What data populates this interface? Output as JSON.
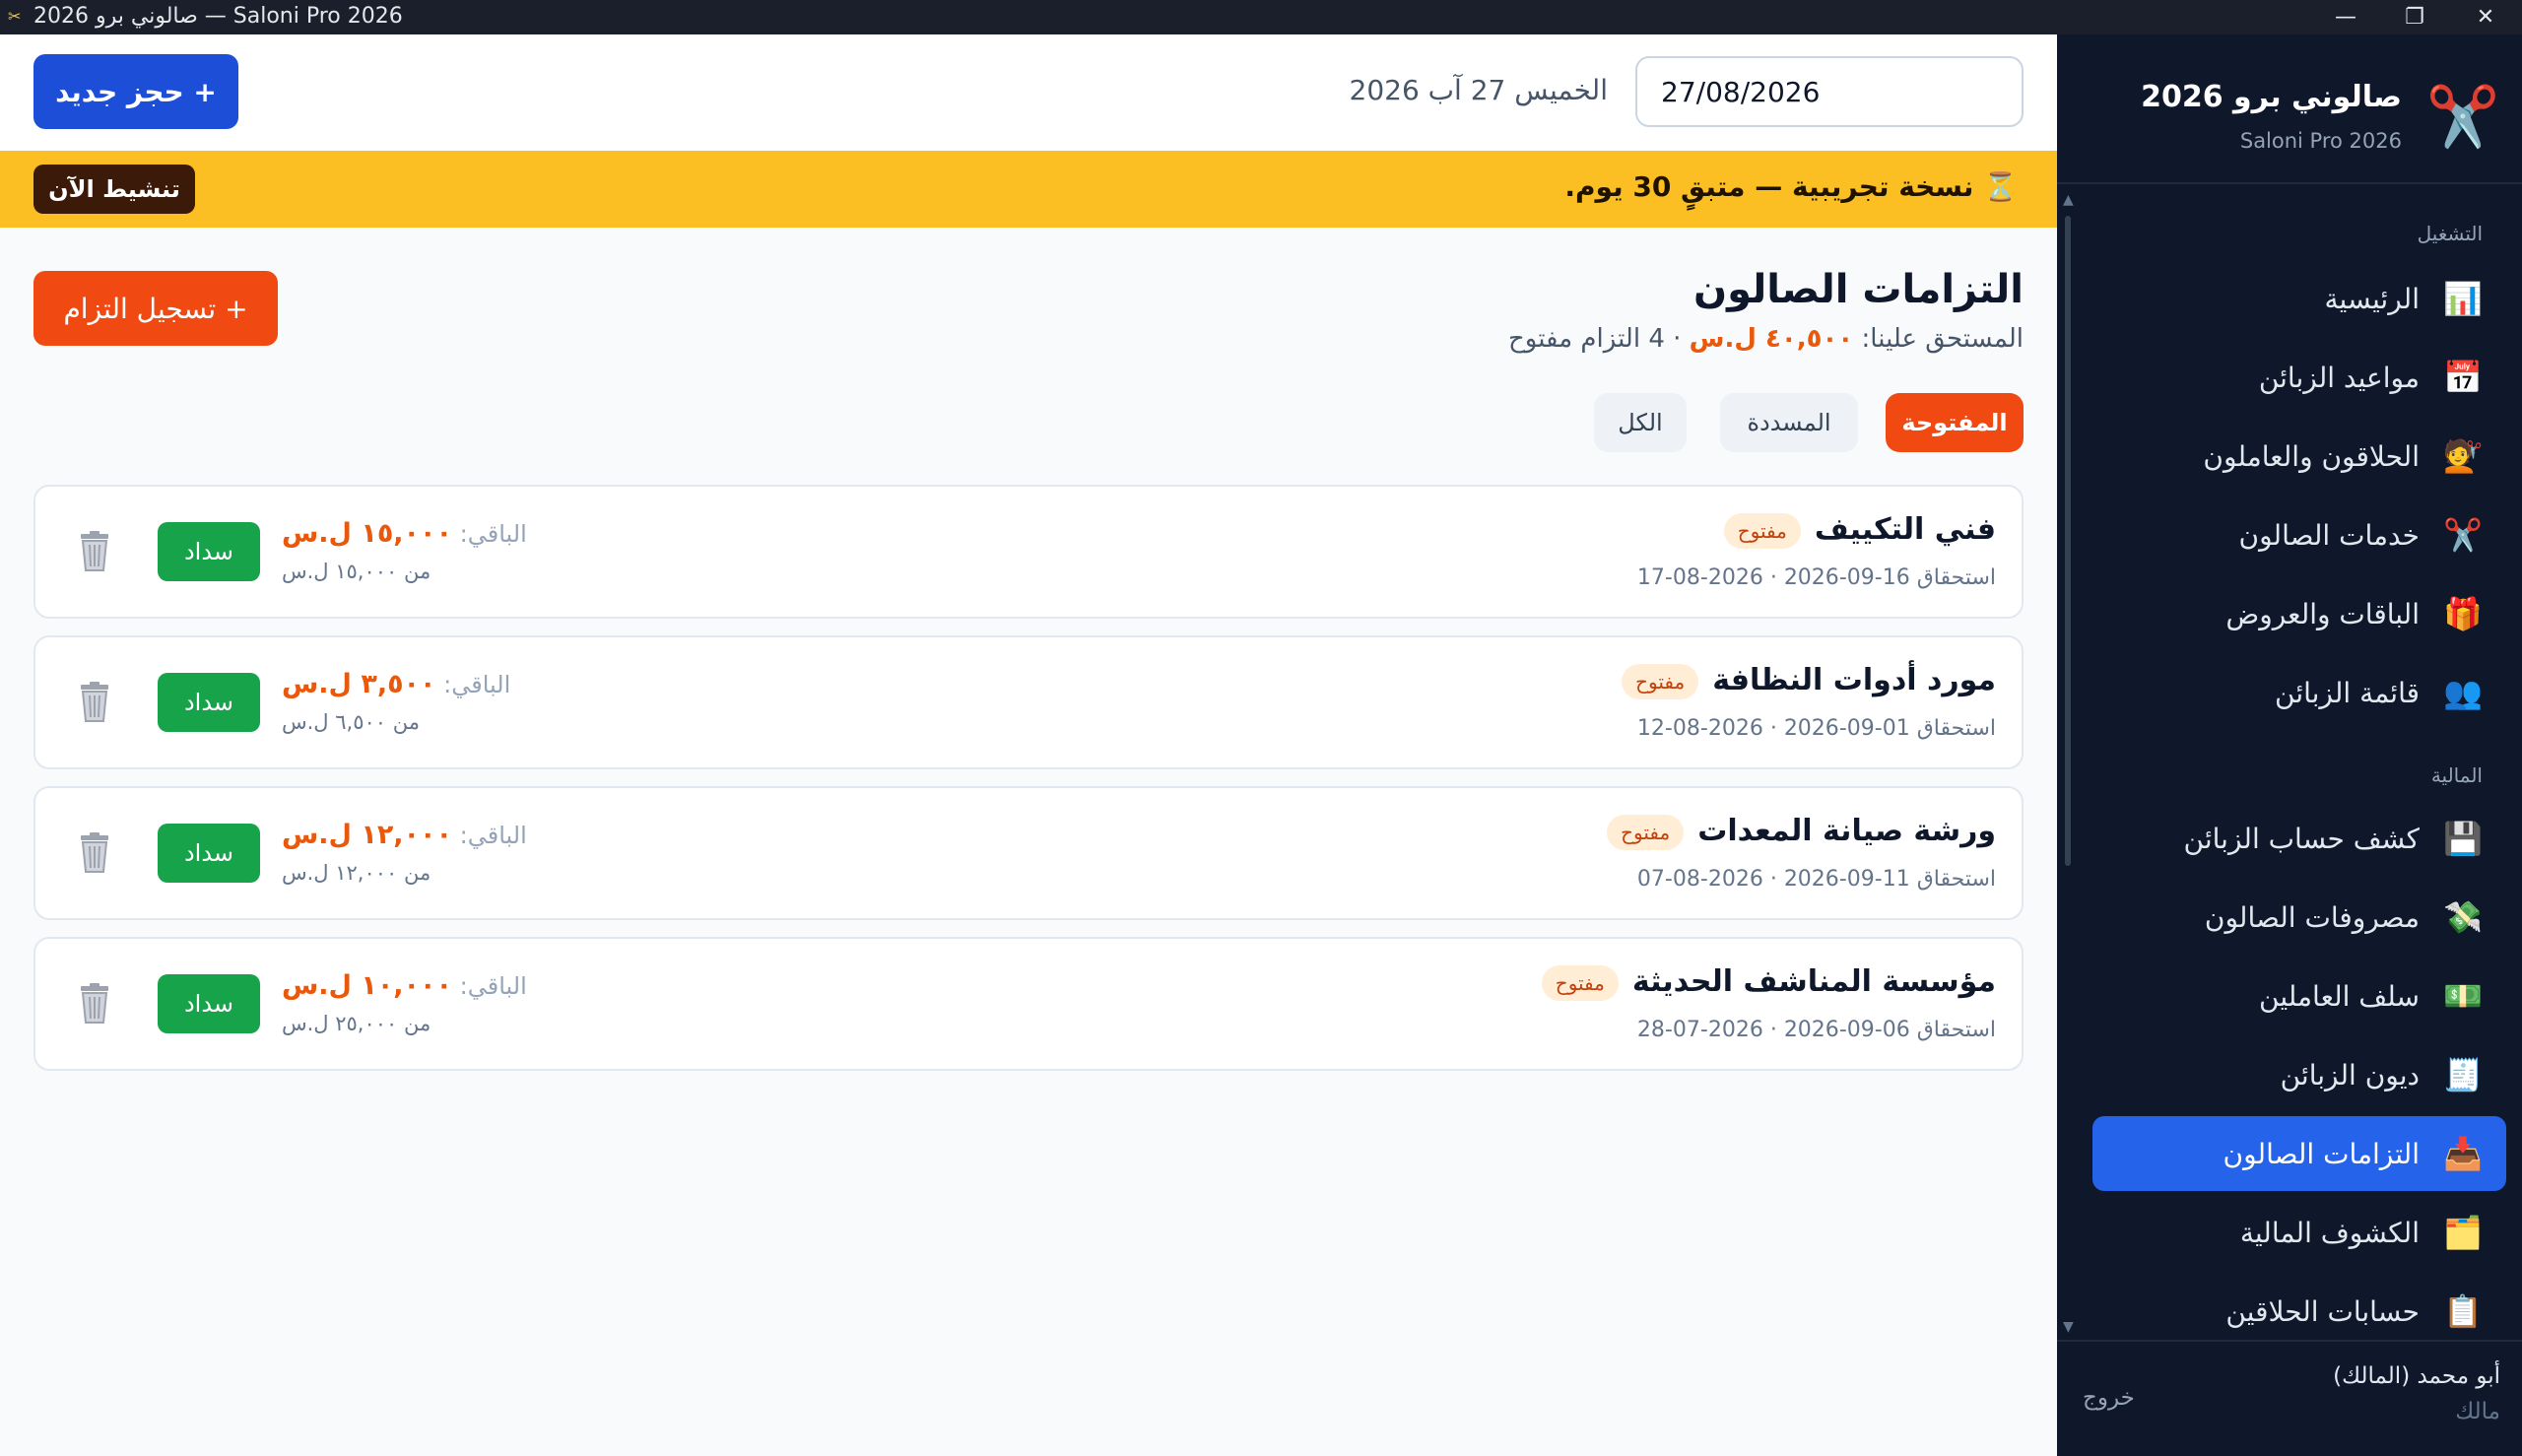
{
  "window": {
    "title": "صالوني برو 2026 — Saloni Pro 2026",
    "controls": {
      "minimize": "—",
      "maximize": "❐",
      "close": "✕"
    }
  },
  "sidebar": {
    "brand_name": "صالوني برو 2026",
    "brand_sub": "Saloni Pro 2026",
    "brand_icon": "scissors-logo-icon",
    "sections": [
      {
        "label": "التشغيل",
        "items": [
          {
            "label": "الرئيسية",
            "icon": "📊"
          },
          {
            "label": "مواعيد الزبائن",
            "icon": "📅"
          },
          {
            "label": "الحلاقون والعاملون",
            "icon": "💇"
          },
          {
            "label": "خدمات الصالون",
            "icon": "✂️"
          },
          {
            "label": "الباقات والعروض",
            "icon": "🎁"
          },
          {
            "label": "قائمة الزبائن",
            "icon": "👥"
          }
        ]
      },
      {
        "label": "المالية",
        "items": [
          {
            "label": "كشف حساب الزبائن",
            "icon": "💾"
          },
          {
            "label": "مصروفات الصالون",
            "icon": "💸"
          },
          {
            "label": "سلف العاملين",
            "icon": "💵"
          },
          {
            "label": "ديون الزبائن",
            "icon": "🧾"
          },
          {
            "label": "التزامات الصالون",
            "icon": "📥",
            "active": true
          },
          {
            "label": "الكشوف المالية",
            "icon": "🗂️"
          },
          {
            "label": "حسابات الحلاقين",
            "icon": "📋"
          }
        ]
      }
    ],
    "user": {
      "name": "أبو محمد (المالك)",
      "role": "مالك",
      "logout": "خروج"
    }
  },
  "topbar": {
    "date_value": "27/08/2026",
    "date_label": "الخميس 27 آب 2026",
    "new_booking": "+ حجز جديد"
  },
  "trial": {
    "icon": "⏳",
    "text": "نسخة تجريبية — متبقٍ 30 يوم.",
    "activate": "تنشيط الآن"
  },
  "page": {
    "title": "التزامات الصالون",
    "summary_prefix": "المستحق علينا:",
    "summary_amount": "٤٠,٥٠٠ ل.س",
    "summary_suffix": "· 4 التزام مفتوح",
    "record_button": "+ تسجيل التزام"
  },
  "tabs": {
    "open": "المفتوحة",
    "paid": "المسددة",
    "all": "الكل"
  },
  "obligations": [
    {
      "name": "فني التكييف",
      "status": "مفتوح",
      "dates": "استحقاق 16-09-2026 · 2026-08-17",
      "remaining_label": "الباقي:",
      "remaining": "١٥,٠٠٠ ل.س",
      "of": "من ١٥,٠٠٠ ل.س",
      "pay": "سداد"
    },
    {
      "name": "مورد أدوات النظافة",
      "status": "مفتوح",
      "dates": "استحقاق 01-09-2026 · 2026-08-12",
      "remaining_label": "الباقي:",
      "remaining": "٣,٥٠٠ ل.س",
      "of": "من ٦,٥٠٠ ل.س",
      "pay": "سداد"
    },
    {
      "name": "ورشة صيانة المعدات",
      "status": "مفتوح",
      "dates": "استحقاق 11-09-2026 · 2026-08-07",
      "remaining_label": "الباقي:",
      "remaining": "١٢,٠٠٠ ل.س",
      "of": "من ١٢,٠٠٠ ل.س",
      "pay": "سداد"
    },
    {
      "name": "مؤسسة المناشف الحديثة",
      "status": "مفتوح",
      "dates": "استحقاق 06-09-2026 · 2026-07-28",
      "remaining_label": "الباقي:",
      "remaining": "١٠,٠٠٠ ل.س",
      "of": "من ٢٥,٠٠٠ ل.س",
      "pay": "سداد"
    }
  ],
  "colors": {
    "accent": "#f04a12",
    "primary": "#1d4ed8",
    "sidebar_bg": "#0f172a",
    "trial_bg": "#fbbf24",
    "pay": "#16a34a"
  }
}
